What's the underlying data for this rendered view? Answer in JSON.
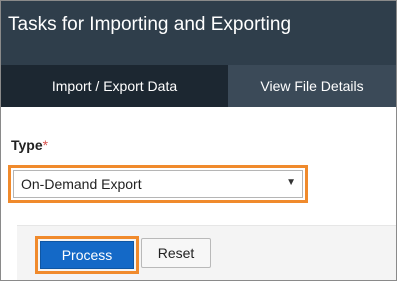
{
  "header": {
    "title": "Tasks for Importing and Exporting"
  },
  "tabs": [
    {
      "label": "Import / Export Data",
      "active": true
    },
    {
      "label": "View File Details",
      "active": false
    }
  ],
  "form": {
    "type_label": "Type",
    "required_mark": "*",
    "type_value": "On-Demand Export",
    "dropdown_icon": "caret-down-icon"
  },
  "actions": {
    "process_label": "Process",
    "reset_label": "Reset"
  },
  "colors": {
    "header_bg": "#2f3e4b",
    "tab_bar_bg": "#3b4a58",
    "active_tab_bg": "#1c2731",
    "primary_button": "#1469c7",
    "highlight": "#f08a2c",
    "required": "#d9534f"
  }
}
